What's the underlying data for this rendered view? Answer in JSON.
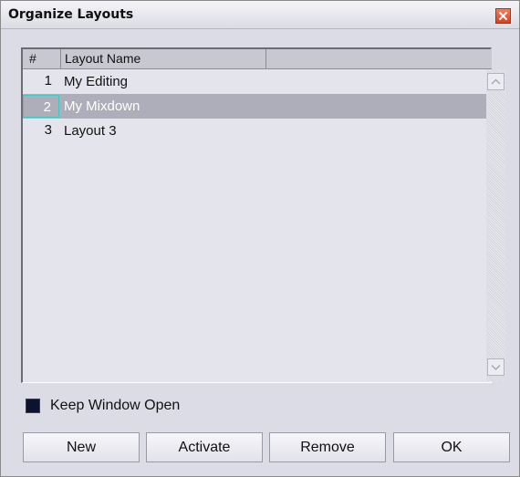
{
  "window": {
    "title": "Organize Layouts",
    "close_icon": "close-icon"
  },
  "list": {
    "columns": [
      "#",
      "Layout Name"
    ],
    "rows": [
      {
        "num": "1",
        "name": "My Editing",
        "selected": false
      },
      {
        "num": "2",
        "name": "My Mixdown",
        "selected": true
      },
      {
        "num": "3",
        "name": "Layout 3",
        "selected": false
      }
    ]
  },
  "options": {
    "keep_window_open_label": "Keep Window Open",
    "keep_window_open_checked": true
  },
  "buttons": {
    "new": "New",
    "activate": "Activate",
    "remove": "Remove",
    "ok": "OK"
  },
  "colors": {
    "selection": "#aeaeba",
    "window_bg": "#dcdce6",
    "close": "#e05030",
    "focus_outline": "#40c8c8"
  }
}
